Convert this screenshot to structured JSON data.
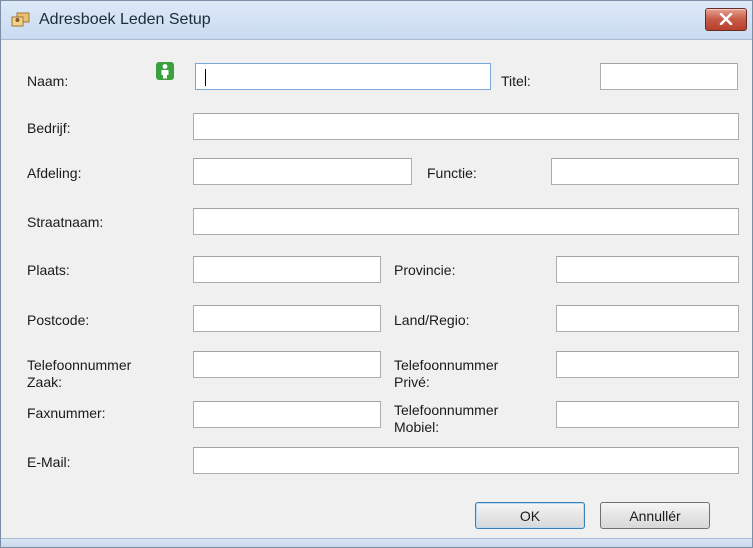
{
  "window": {
    "title": "Adresboek Leden Setup",
    "close_icon": "close-icon",
    "app_icon": "address-book-icon"
  },
  "form": {
    "naam": {
      "label": "Naam:",
      "value": "",
      "icon": "person-icon"
    },
    "titel": {
      "label": "Titel:",
      "value": ""
    },
    "bedrijf": {
      "label": "Bedrijf:",
      "value": ""
    },
    "afdeling": {
      "label": "Afdeling:",
      "value": ""
    },
    "functie": {
      "label": "Functie:",
      "value": ""
    },
    "straatnaam": {
      "label": "Straatnaam:",
      "value": ""
    },
    "plaats": {
      "label": "Plaats:",
      "value": ""
    },
    "provincie": {
      "label": "Provincie:",
      "value": ""
    },
    "postcode": {
      "label": "Postcode:",
      "value": ""
    },
    "land_regio": {
      "label": "Land/Regio:",
      "value": ""
    },
    "telefoon_zaak": {
      "label_line1": "Telefoonnummer",
      "label_line2": "Zaak:",
      "value": ""
    },
    "telefoon_prive": {
      "label_line1": "Telefoonnummer",
      "label_line2": "Privé:",
      "value": ""
    },
    "faxnummer": {
      "label": "Faxnummer:",
      "value": ""
    },
    "telefoon_mobiel": {
      "label_line1": "Telefoonnummer",
      "label_line2": "Mobiel:",
      "value": ""
    },
    "email": {
      "label": "E-Mail:",
      "value": ""
    }
  },
  "buttons": {
    "ok": "OK",
    "cancel": "Annullér"
  },
  "colors": {
    "title_bar": "#c9dbf0",
    "close_button": "#c75a46",
    "person_icon": "#3ba03d",
    "dialog_background": "#f0f0f0"
  }
}
